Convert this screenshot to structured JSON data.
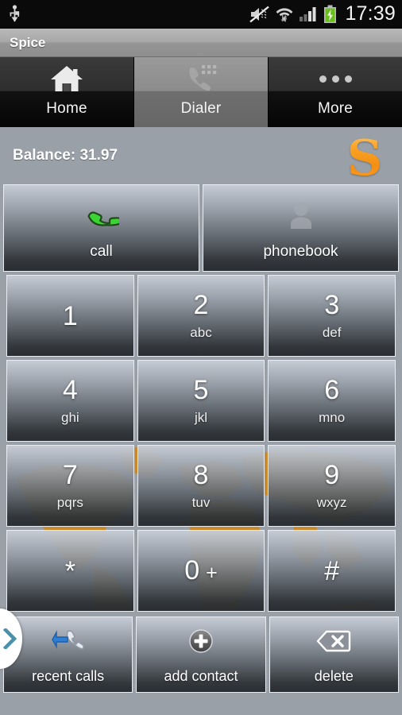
{
  "statusbar": {
    "time": "17:39",
    "icons": [
      "usb-icon",
      "sound-muted-icon",
      "wifi-icon",
      "signal-bars-icon",
      "battery-charging-icon"
    ]
  },
  "titlebar": {
    "title": "Spice"
  },
  "tabs": [
    {
      "label": "Home",
      "icon": "home-icon",
      "selected": false
    },
    {
      "label": "Dialer",
      "icon": "dialer-icon",
      "selected": true
    },
    {
      "label": "More",
      "icon": "more-dots-icon",
      "selected": false
    }
  ],
  "balance": {
    "label": "Balance: 31.97",
    "logo_letter": "S",
    "logo_color": "#f28f14"
  },
  "actions": [
    {
      "label": "call",
      "icon": "green-phone-icon"
    },
    {
      "label": "phonebook",
      "icon": "person-silhouette-icon"
    }
  ],
  "keypad": [
    {
      "digit": "1",
      "letters": ""
    },
    {
      "digit": "2",
      "letters": "abc"
    },
    {
      "digit": "3",
      "letters": "def"
    },
    {
      "digit": "4",
      "letters": "ghi"
    },
    {
      "digit": "5",
      "letters": "jkl"
    },
    {
      "digit": "6",
      "letters": "mno"
    },
    {
      "digit": "7",
      "letters": "pqrs"
    },
    {
      "digit": "8",
      "letters": "tuv"
    },
    {
      "digit": "9",
      "letters": "wxyz"
    },
    {
      "digit": "*",
      "letters": ""
    },
    {
      "digit": "0",
      "letters": "",
      "secondary": "+"
    },
    {
      "digit": "#",
      "letters": ""
    }
  ],
  "utilities": [
    {
      "label": "recent calls",
      "icon": "recent-calls-icon"
    },
    {
      "label": "add contact",
      "icon": "add-contact-icon"
    },
    {
      "label": "delete",
      "icon": "backspace-delete-icon"
    }
  ],
  "drawer": {
    "handle_icon": "chevron-right-icon",
    "handle_color": "#4a90ab"
  }
}
